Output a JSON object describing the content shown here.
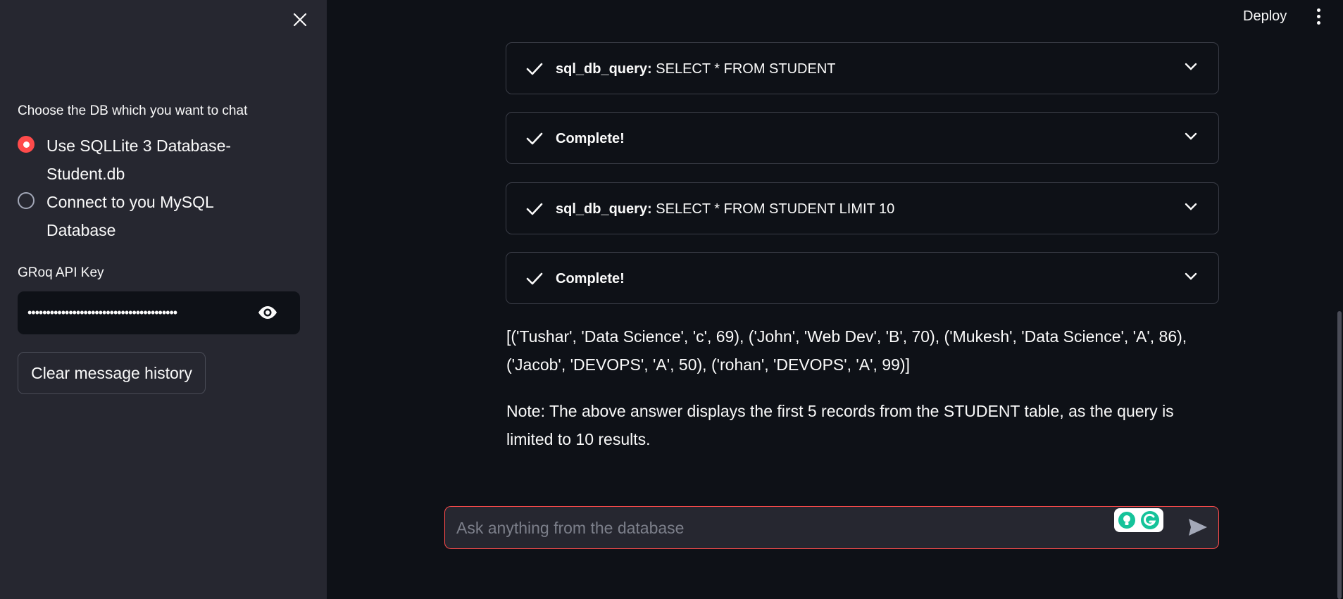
{
  "header": {
    "deploy_label": "Deploy"
  },
  "sidebar": {
    "db_label": "Choose the DB which you want to chat",
    "options": [
      {
        "label": "Use SQLLite 3 Database- Student.db",
        "selected": true
      },
      {
        "label": "Connect to you MySQL Database",
        "selected": false
      }
    ],
    "api_key_label": "GRoq API Key",
    "api_key_value": "••••••••••••••••••••••••••••••••••••••••",
    "clear_button": "Clear message history"
  },
  "chat": {
    "steps": [
      {
        "tool": "sql_db_query:",
        "text": " SELECT * FROM STUDENT"
      },
      {
        "tool": "Complete!",
        "text": ""
      },
      {
        "tool": "sql_db_query:",
        "text": " SELECT * FROM STUDENT LIMIT 10"
      },
      {
        "tool": "Complete!",
        "text": ""
      }
    ],
    "result": "[('Tushar', 'Data Science', 'c', 69), ('John', 'Web Dev', 'B', 70), ('Mukesh', 'Data Science', 'A', 86), ('Jacob', 'DEVOPS', 'A', 50), ('rohan', 'DEVOPS', 'A', 99)]",
    "note": "Note: The above answer displays the first 5 records from the STUDENT table, as the query is limited to 10 results.",
    "input_placeholder": "Ask anything from the database"
  },
  "colors": {
    "accent": "#ff4b4b",
    "background": "#0e1117",
    "sidebar": "#262730"
  }
}
